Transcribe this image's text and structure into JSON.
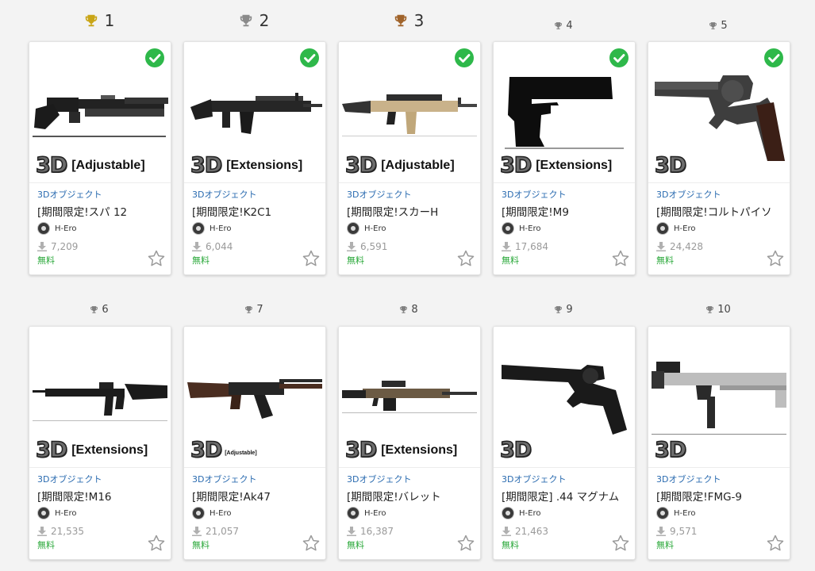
{
  "colors": {
    "check": "#2eb84a",
    "price": "#2aa83a",
    "category": "#2a6bb0"
  },
  "items": [
    {
      "rank": "1",
      "medal": "gold",
      "category": "3Dオブジェクト",
      "title": "[期間限定!スパ 12",
      "author": "H-Ero",
      "downloads": "7,209",
      "price": "無料",
      "tag": "[Adjustable]",
      "checked": true,
      "gun": "shotgun"
    },
    {
      "rank": "2",
      "medal": "silver",
      "category": "3Dオブジェクト",
      "title": "[期間限定!K2C1",
      "author": "H-Ero",
      "downloads": "6,044",
      "price": "無料",
      "tag": "[Extensions]",
      "checked": true,
      "gun": "rifle"
    },
    {
      "rank": "3",
      "medal": "bronze",
      "category": "3Dオブジェクト",
      "title": "[期間限定!スカーH",
      "author": "H-Ero",
      "downloads": "6,591",
      "price": "無料",
      "tag": "[Adjustable]",
      "checked": true,
      "gun": "scar"
    },
    {
      "rank": "4",
      "medal": "gray",
      "category": "3Dオブジェクト",
      "title": "[期間限定!M9",
      "author": "H-Ero",
      "downloads": "17,684",
      "price": "無料",
      "tag": "[Extensions]",
      "checked": true,
      "gun": "pistol"
    },
    {
      "rank": "5",
      "medal": "gray",
      "category": "3Dオブジェクト",
      "title": "[期間限定!コルトパイソ",
      "author": "H-Ero",
      "downloads": "24,428",
      "price": "無料",
      "tag": "",
      "checked": true,
      "gun": "revolver"
    },
    {
      "rank": "6",
      "medal": "gray",
      "category": "3Dオブジェクト",
      "title": "[期間限定!M16",
      "author": "H-Ero",
      "downloads": "21,535",
      "price": "無料",
      "tag": "[Extensions]",
      "checked": false,
      "gun": "m16"
    },
    {
      "rank": "7",
      "medal": "gray",
      "category": "3Dオブジェクト",
      "title": "[期間限定!Ak47",
      "author": "H-Ero",
      "downloads": "21,057",
      "price": "無料",
      "tag": "[Adjustable]",
      "checked": false,
      "gun": "ak"
    },
    {
      "rank": "8",
      "medal": "gray",
      "category": "3Dオブジェクト",
      "title": "[期間限定!バレット",
      "author": "H-Ero",
      "downloads": "16,387",
      "price": "無料",
      "tag": "[Extensions]",
      "checked": false,
      "gun": "sniper"
    },
    {
      "rank": "9",
      "medal": "gray",
      "category": "3Dオブジェクト",
      "title": "[期間限定] .44 マグナム",
      "author": "H-Ero",
      "downloads": "21,463",
      "price": "無料",
      "tag": "",
      "checked": false,
      "gun": "magnum"
    },
    {
      "rank": "10",
      "medal": "gray",
      "category": "3Dオブジェクト",
      "title": "[期間限定!FMG-9",
      "author": "H-Ero",
      "downloads": "9,571",
      "price": "無料",
      "tag": "",
      "checked": false,
      "gun": "fmg"
    }
  ]
}
